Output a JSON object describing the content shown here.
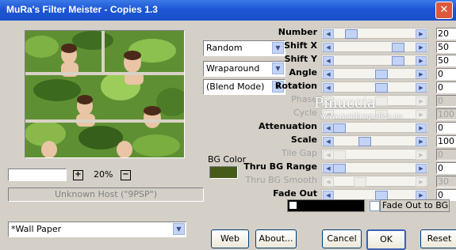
{
  "window": {
    "title": "MuRa's Filter Meister - Copies 1.3",
    "close_glyph": "✕"
  },
  "preview": {
    "zoom": "20%",
    "zoom_in": "+",
    "zoom_out": "−",
    "host": "Unknown Host (\"9PSP\")"
  },
  "dropdowns": [
    {
      "value": "Random"
    },
    {
      "value": "Wraparound"
    },
    {
      "value": "(Blend Mode)"
    }
  ],
  "bg_color": {
    "label": "BG Color",
    "color": "#465b1a"
  },
  "params": [
    {
      "label": "Number",
      "value": "20",
      "level": 0.14,
      "enabled": true
    },
    {
      "label": "Shift X",
      "value": "50",
      "level": 0.7,
      "enabled": true
    },
    {
      "label": "Shift Y",
      "value": "50",
      "level": 0.7,
      "enabled": true
    },
    {
      "label": "Angle",
      "value": "0",
      "level": 0.5,
      "enabled": true
    },
    {
      "label": "Rotation",
      "value": "0",
      "level": 0.5,
      "enabled": true
    },
    {
      "label": "Phase",
      "value": "0",
      "level": 0.5,
      "enabled": false
    },
    {
      "label": "Cycle",
      "value": "100",
      "level": 0.5,
      "enabled": false
    },
    {
      "label": "Attenuation",
      "value": "0",
      "level": 0.0,
      "enabled": true
    },
    {
      "label": "Scale",
      "value": "100",
      "level": 0.3,
      "enabled": true
    },
    {
      "label": "Tile Gap",
      "value": "0",
      "level": 0.0,
      "enabled": false
    },
    {
      "label": "Thru BG Range",
      "value": "0",
      "level": 0.0,
      "enabled": true
    },
    {
      "label": "Thru BG Smooth",
      "value": "30",
      "level": 0.25,
      "enabled": false
    },
    {
      "label": "Fade Out",
      "value": "0",
      "level": 0.5,
      "enabled": true
    }
  ],
  "watermark": {
    "name": "Pinuccia",
    "site": "www.maidiregrafica.eu"
  },
  "fade": {
    "label": "Fade Out to BG"
  },
  "preset": {
    "value": "*Wall Paper"
  },
  "buttons": {
    "web": "Web",
    "about": "About...",
    "cancel": "Cancel",
    "ok": "OK",
    "reset": "Reset"
  },
  "icons": {
    "left": "◀",
    "right": "▶",
    "down": "▼"
  }
}
